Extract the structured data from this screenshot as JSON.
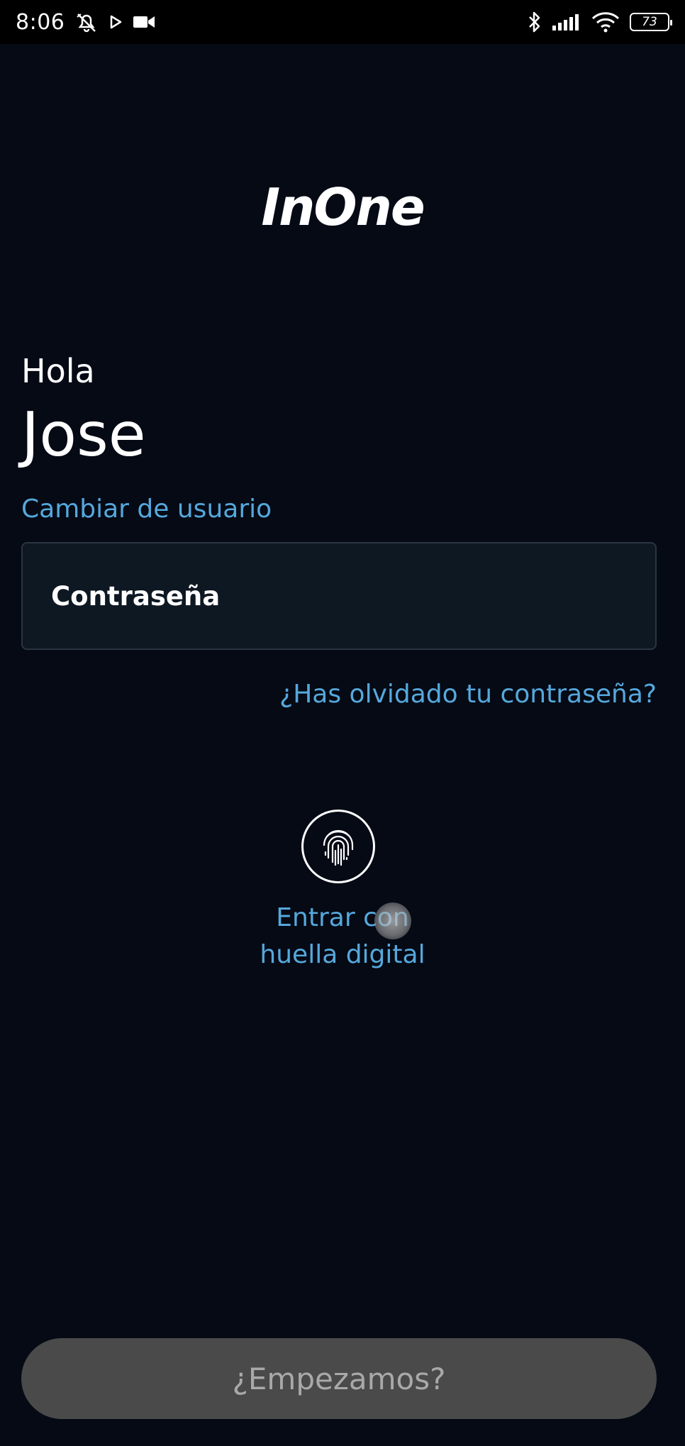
{
  "status_bar": {
    "time": "8:06",
    "battery": "73",
    "icons": [
      "mute-alarm-icon",
      "play-icon",
      "video-camera-icon",
      "bluetooth-icon",
      "signal-icon",
      "wifi-icon",
      "battery-icon"
    ]
  },
  "app": {
    "logo": "InOne"
  },
  "greeting": {
    "hello": "Hola",
    "name": "Jose",
    "change_user": "Cambiar de usuario"
  },
  "password": {
    "placeholder": "Contraseña",
    "value": ""
  },
  "forgot_password": "¿Has olvidado tu contraseña?",
  "fingerprint": {
    "label_line1": "Entrar con",
    "label_line2": "huella digital",
    "icon": "fingerprint-icon"
  },
  "start_button": "¿Empezamos?",
  "colors": {
    "background": "#050a15",
    "link": "#56a8dc",
    "button_disabled": "#4a4a4a",
    "button_text_disabled": "#a9a9a9",
    "field_background": "#0e1823"
  }
}
